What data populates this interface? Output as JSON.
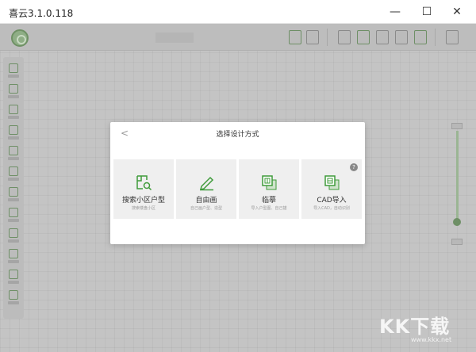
{
  "window": {
    "title": "喜云3.1.0.118",
    "minimize_glyph": "—",
    "maximize_glyph": "☐",
    "close_glyph": "✕"
  },
  "modal": {
    "back_glyph": "<",
    "title": "选择设计方式",
    "help_glyph": "?",
    "options": [
      {
        "label": "搜索小区户型",
        "sub": "搜索楼盘小区",
        "icon": "floorplan-search-icon"
      },
      {
        "label": "自由画",
        "sub": "自己画户型、造型",
        "icon": "pencil-draw-icon"
      },
      {
        "label": "临摹",
        "sub": "导入户型图、自己描",
        "icon": "trace-icon"
      },
      {
        "label": "CAD导入",
        "sub": "导入CAD，自动识别",
        "icon": "cad-import-icon"
      }
    ]
  },
  "watermark": {
    "text": "KK下载",
    "url": "www.kkx.net"
  },
  "colors": {
    "accent": "#3f9b3a",
    "overlay": "#c4c4c4",
    "card": "#efefef"
  }
}
